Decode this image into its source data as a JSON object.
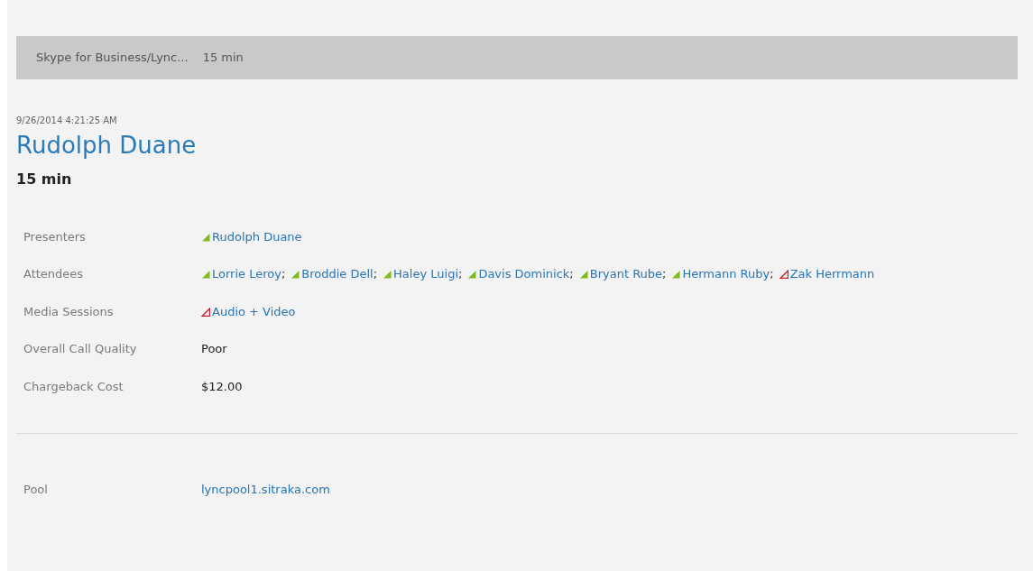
{
  "header_bar": {
    "title": "Skype for Business/Lync...",
    "duration": "15 min"
  },
  "timestamp": "9/26/2014 4:21:25 AM",
  "title": "Rudolph Duane",
  "duration": "15 min",
  "details": [
    {
      "label": "Presenters",
      "kind": "people",
      "items": [
        {
          "name": "Rudolph Duane",
          "poor_quality": false
        }
      ]
    },
    {
      "label": "Attendees",
      "kind": "people",
      "separator": ";",
      "items": [
        {
          "name": "Lorrie Leroy",
          "poor_quality": false
        },
        {
          "name": "Broddie Dell",
          "poor_quality": false
        },
        {
          "name": "Haley Luigi",
          "poor_quality": false
        },
        {
          "name": "Davis Dominick",
          "poor_quality": false
        },
        {
          "name": "Bryant Rube",
          "poor_quality": false
        },
        {
          "name": "Hermann Ruby",
          "poor_quality": false
        },
        {
          "name": "Zak Herrmann",
          "poor_quality": true
        }
      ]
    },
    {
      "label": "Media Sessions",
      "kind": "people",
      "items": [
        {
          "name": "Audio + Video",
          "poor_quality": true
        }
      ]
    },
    {
      "label": "Overall Call Quality",
      "kind": "text",
      "value": "Poor"
    },
    {
      "label": "Chargeback Cost",
      "kind": "text",
      "value": "$12.00"
    }
  ],
  "footer_details": [
    {
      "label": "Pool",
      "kind": "link",
      "value": "lyncpool1.sitraka.com"
    }
  ]
}
